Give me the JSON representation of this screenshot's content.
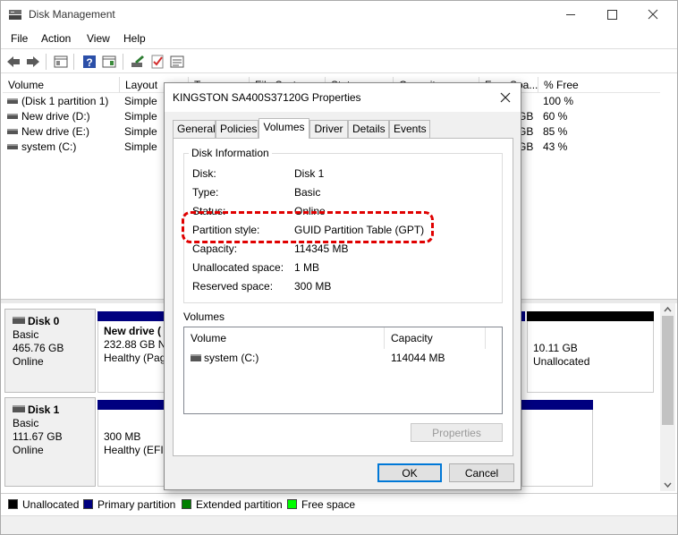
{
  "app": {
    "title": "Disk Management"
  },
  "menu": [
    "File",
    "Action",
    "View",
    "Help"
  ],
  "volumes": {
    "columns": [
      "Volume",
      "Layout",
      "Type",
      "File System",
      "Status",
      "Capacity",
      "Free Spa...",
      "% Free"
    ],
    "rows": [
      {
        "volume": "(Disk 1 partition 1)",
        "layout": "Simple",
        "free_frag": "",
        "pct": "100 %"
      },
      {
        "volume": "New drive (D:)",
        "layout": "Simple",
        "free_frag": "GB",
        "pct": "60 %"
      },
      {
        "volume": "New drive (E:)",
        "layout": "Simple",
        "free_frag": "GB",
        "pct": "85 %"
      },
      {
        "volume": "system (C:)",
        "layout": "Simple",
        "free_frag": "GB",
        "pct": "43 %"
      }
    ]
  },
  "disks": [
    {
      "name": "Disk 0",
      "type": "Basic",
      "size": "465.76 GB",
      "status": "Online",
      "part1": {
        "name": "New drive (",
        "size": "232.88 GB NT",
        "status": "Healthy (Pag"
      },
      "unalloc": {
        "size": "10.11 GB",
        "status": "Unallocated"
      }
    },
    {
      "name": "Disk 1",
      "type": "Basic",
      "size": "111.67 GB",
      "status": "Online",
      "part1": {
        "size": "300 MB",
        "status": "Healthy (EFI S"
      }
    }
  ],
  "legend": [
    {
      "label": "Unallocated",
      "color": "#000000"
    },
    {
      "label": "Primary partition",
      "color": "#00007f"
    },
    {
      "label": "Extended partition",
      "color": "#008000"
    },
    {
      "label": "Free space",
      "color": "#00ff00"
    }
  ],
  "dialog": {
    "title": "KINGSTON SA400S37120G Properties",
    "tabs": [
      "General",
      "Policies",
      "Volumes",
      "Driver",
      "Details",
      "Events"
    ],
    "active_tab": "Volumes",
    "disk_info_label": "Disk Information",
    "fields": [
      {
        "label": "Disk:",
        "value": "Disk 1"
      },
      {
        "label": "Type:",
        "value": "Basic"
      },
      {
        "label": "Status:",
        "value": "Online"
      },
      {
        "label": "Partition style:",
        "value": "GUID Partition Table (GPT)"
      },
      {
        "label": "Capacity:",
        "value": "114345 MB"
      },
      {
        "label": "Unallocated space:",
        "value": "1 MB"
      },
      {
        "label": "Reserved space:",
        "value": "300 MB"
      }
    ],
    "volumes_label": "Volumes",
    "vol_columns": [
      "Volume",
      "Capacity"
    ],
    "vol_rows": [
      {
        "name": "system (C:)",
        "capacity": "114044 MB"
      }
    ],
    "properties_btn": "Properties",
    "ok_btn": "OK",
    "cancel_btn": "Cancel"
  }
}
